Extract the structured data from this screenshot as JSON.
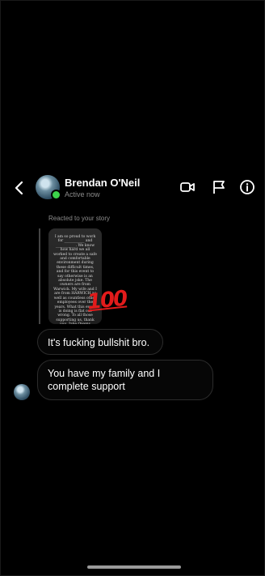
{
  "header": {
    "back_icon": "chevron-left-icon",
    "name": "Brendan O'Neil",
    "status": "Active now",
    "icons": [
      "video-camera-icon",
      "flag-icon",
      "info-icon"
    ],
    "online_color": "#3cd34b"
  },
  "story_reply": {
    "label": "Reacted to your story",
    "story_text": "I am so proud to work for ___________ and ___________. We know how hard we all worked to create a safe and comfortable environment during these difficult times, and for this event to say otherwise is an absolute joke. The owners are from Warwick. My wife and I are from HARWICH as well as countless other employees over the years. What this event is doing is flat out wrong. To all those supporting us, thank you. Jake Owens",
    "reaction_emoji": "💯"
  },
  "messages": [
    {
      "text": "It's fucking bullshit bro."
    },
    {
      "text": "You have my family and I complete support"
    }
  ]
}
